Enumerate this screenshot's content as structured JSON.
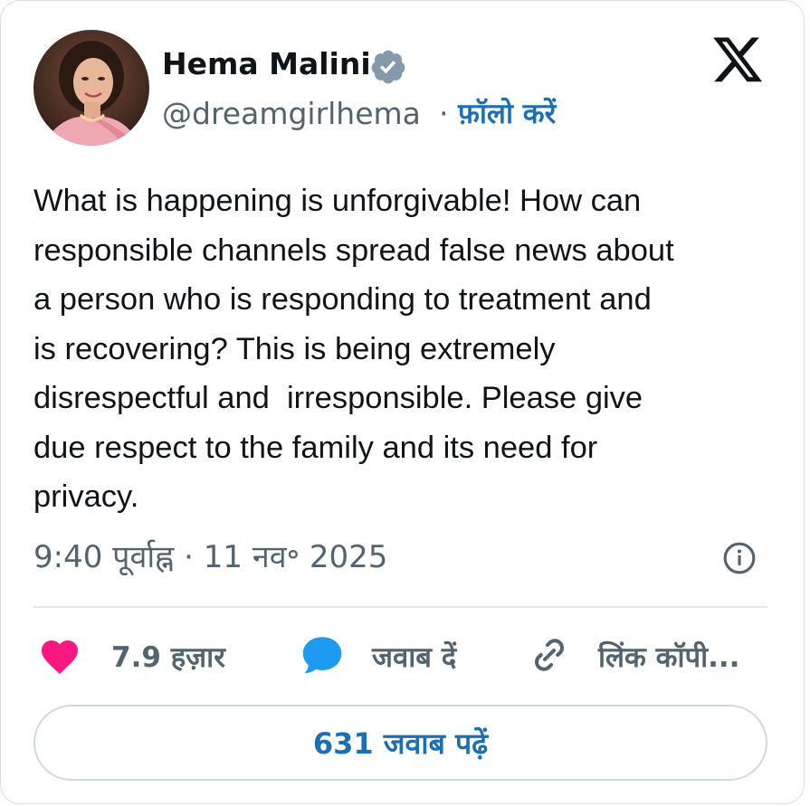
{
  "author": {
    "name": "Hema Malini",
    "handle": "@dreamgirlhema",
    "separator": "·",
    "follow_label": "फ़ॉलो करें",
    "verified_color": "#829aab"
  },
  "brand": {
    "logo": "x-logo-icon"
  },
  "tweet": {
    "text": "What is happening is unforgivable! How can\nresponsible channels spread false news about\na person who is responding to treatment and\nis recovering? This is being extremely\ndisrespectful and  irresponsible. Please give\ndue respect to the family and its need for\nprivacy.",
    "timestamp": "9:40 पूर्वाह्न · 11 नव॰ 2025"
  },
  "actions": {
    "like": {
      "icon": "heart-icon",
      "label": "7.9 हज़ार",
      "color": "#f91880"
    },
    "reply": {
      "icon": "speech-bubble-icon",
      "label": "जवाब दें",
      "color": "#1d9bf0"
    },
    "copy": {
      "icon": "link-icon",
      "label": "लिंक कॉपी..."
    }
  },
  "replies_button": {
    "label": "631 जवाब पढ़ें"
  },
  "colors": {
    "text": "#0f1419",
    "secondary": "#536471",
    "link": "#1d6fb5",
    "border": "#cfd9de"
  }
}
